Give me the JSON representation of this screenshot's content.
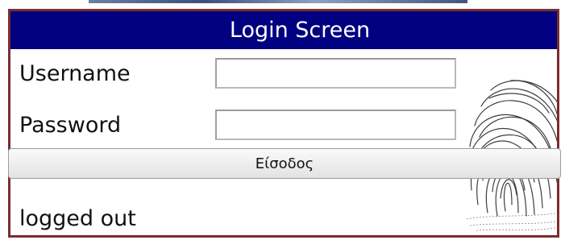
{
  "header": {
    "title": "Login Screen"
  },
  "form": {
    "username_label": "Username",
    "username_value": "",
    "password_label": "Password",
    "password_value": "",
    "submit_label": "Είσοδος"
  },
  "status": {
    "text": "logged out"
  },
  "colors": {
    "title_bar": "#000080",
    "border": "#7a2d2d"
  },
  "icons": {
    "fingerprint": "fingerprint-icon"
  }
}
